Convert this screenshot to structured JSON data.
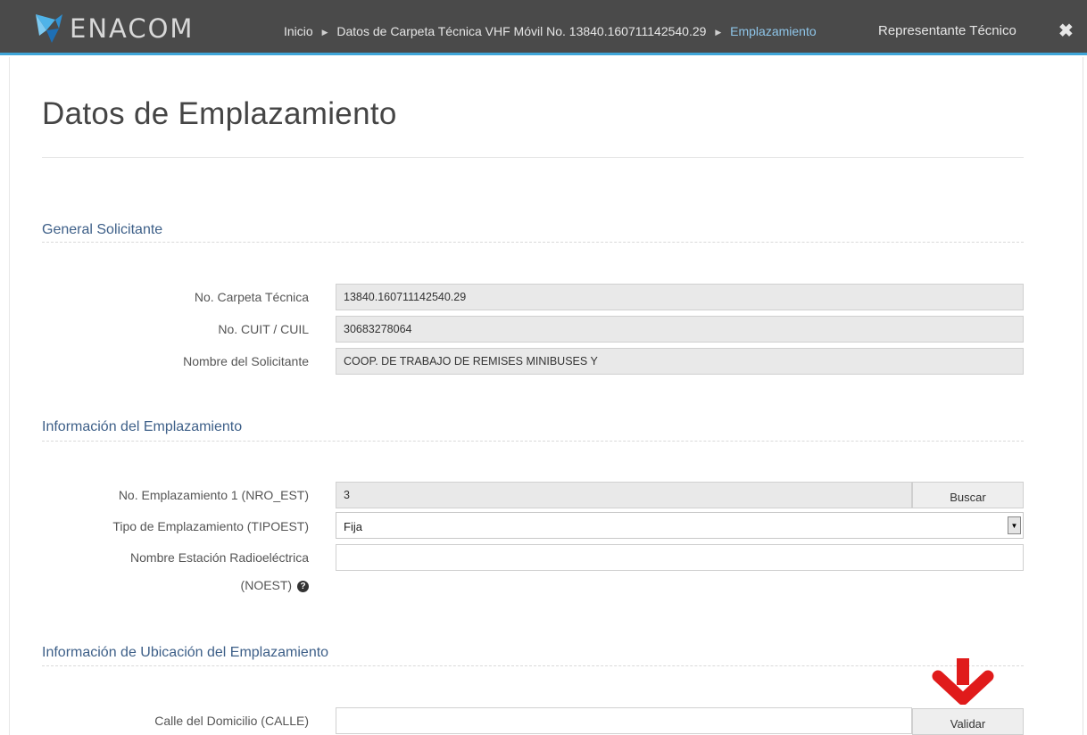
{
  "header": {
    "logo_text": "ENACOM",
    "breadcrumbs": [
      {
        "label": "Inicio"
      },
      {
        "label": "Datos de Carpeta Técnica VHF Móvil No. 13840.160711142540.29"
      },
      {
        "label": "Emplazamiento"
      }
    ],
    "right_title": "Representante Técnico",
    "close_icon": "close-icon",
    "accent_color": "#3fa5d8"
  },
  "page": {
    "title": "Datos de Emplazamiento"
  },
  "sections": {
    "general": {
      "title": "General Solicitante",
      "fields": [
        {
          "label": "No. Carpeta Técnica",
          "value": "13840.160711142540.29"
        },
        {
          "label": "No. CUIT / CUIL",
          "value": "30683278064"
        },
        {
          "label": "Nombre del Solicitante",
          "value": "COOP. DE TRABAJO DE REMISES MINIBUSES Y"
        }
      ]
    },
    "emplazamiento": {
      "title": "Información del Emplazamiento",
      "nro_est": {
        "label": "No. Emplazamiento 1 (NRO_EST)",
        "value": "3",
        "button": "Buscar"
      },
      "tipoest": {
        "label": "Tipo de Emplazamiento (TIPOEST)",
        "value": "Fija"
      },
      "noest": {
        "label_line1": "Nombre Estación Radioeléctrica",
        "label_line2": "(NOEST)",
        "value": "",
        "help_icon": "question-circle-icon"
      }
    },
    "ubicacion": {
      "title": "Información de Ubicación del Emplazamiento",
      "calle": {
        "label": "Calle del Domicilio (CALLE)",
        "value": "",
        "button": "Validar"
      },
      "annotation_icon": "red-down-arrow-icon"
    }
  }
}
